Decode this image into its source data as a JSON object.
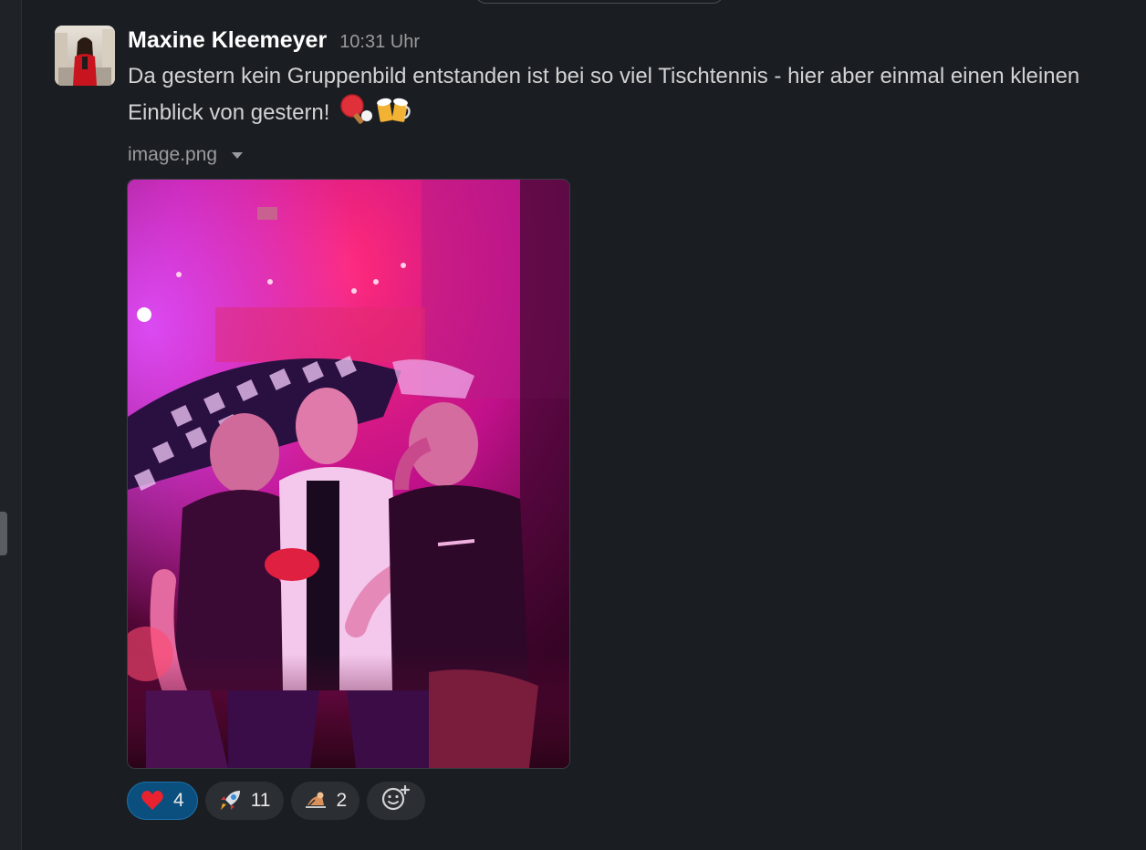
{
  "message": {
    "author": "Maxine Kleemeyer",
    "timestamp": "10:31 Uhr",
    "text": "Da gestern kein Gruppenbild entstanden ist bei so viel Tischtennis - hier aber einmal einen kleinen Einblick von gestern!",
    "inline_emojis": [
      "ping-pong-emoji",
      "beer-mugs-emoji"
    ],
    "attachment": {
      "filename": "image.png"
    }
  },
  "reactions": [
    {
      "emoji": "heart-emoji",
      "count": "4",
      "active": true
    },
    {
      "emoji": "rocket-emoji",
      "count": "11",
      "active": false
    },
    {
      "emoji": "sliding-emoji",
      "count": "2",
      "active": false
    }
  ],
  "colors": {
    "background": "#1a1d21",
    "active_reaction": "#0b4f7f",
    "reaction_bg": "#2b2e33"
  }
}
